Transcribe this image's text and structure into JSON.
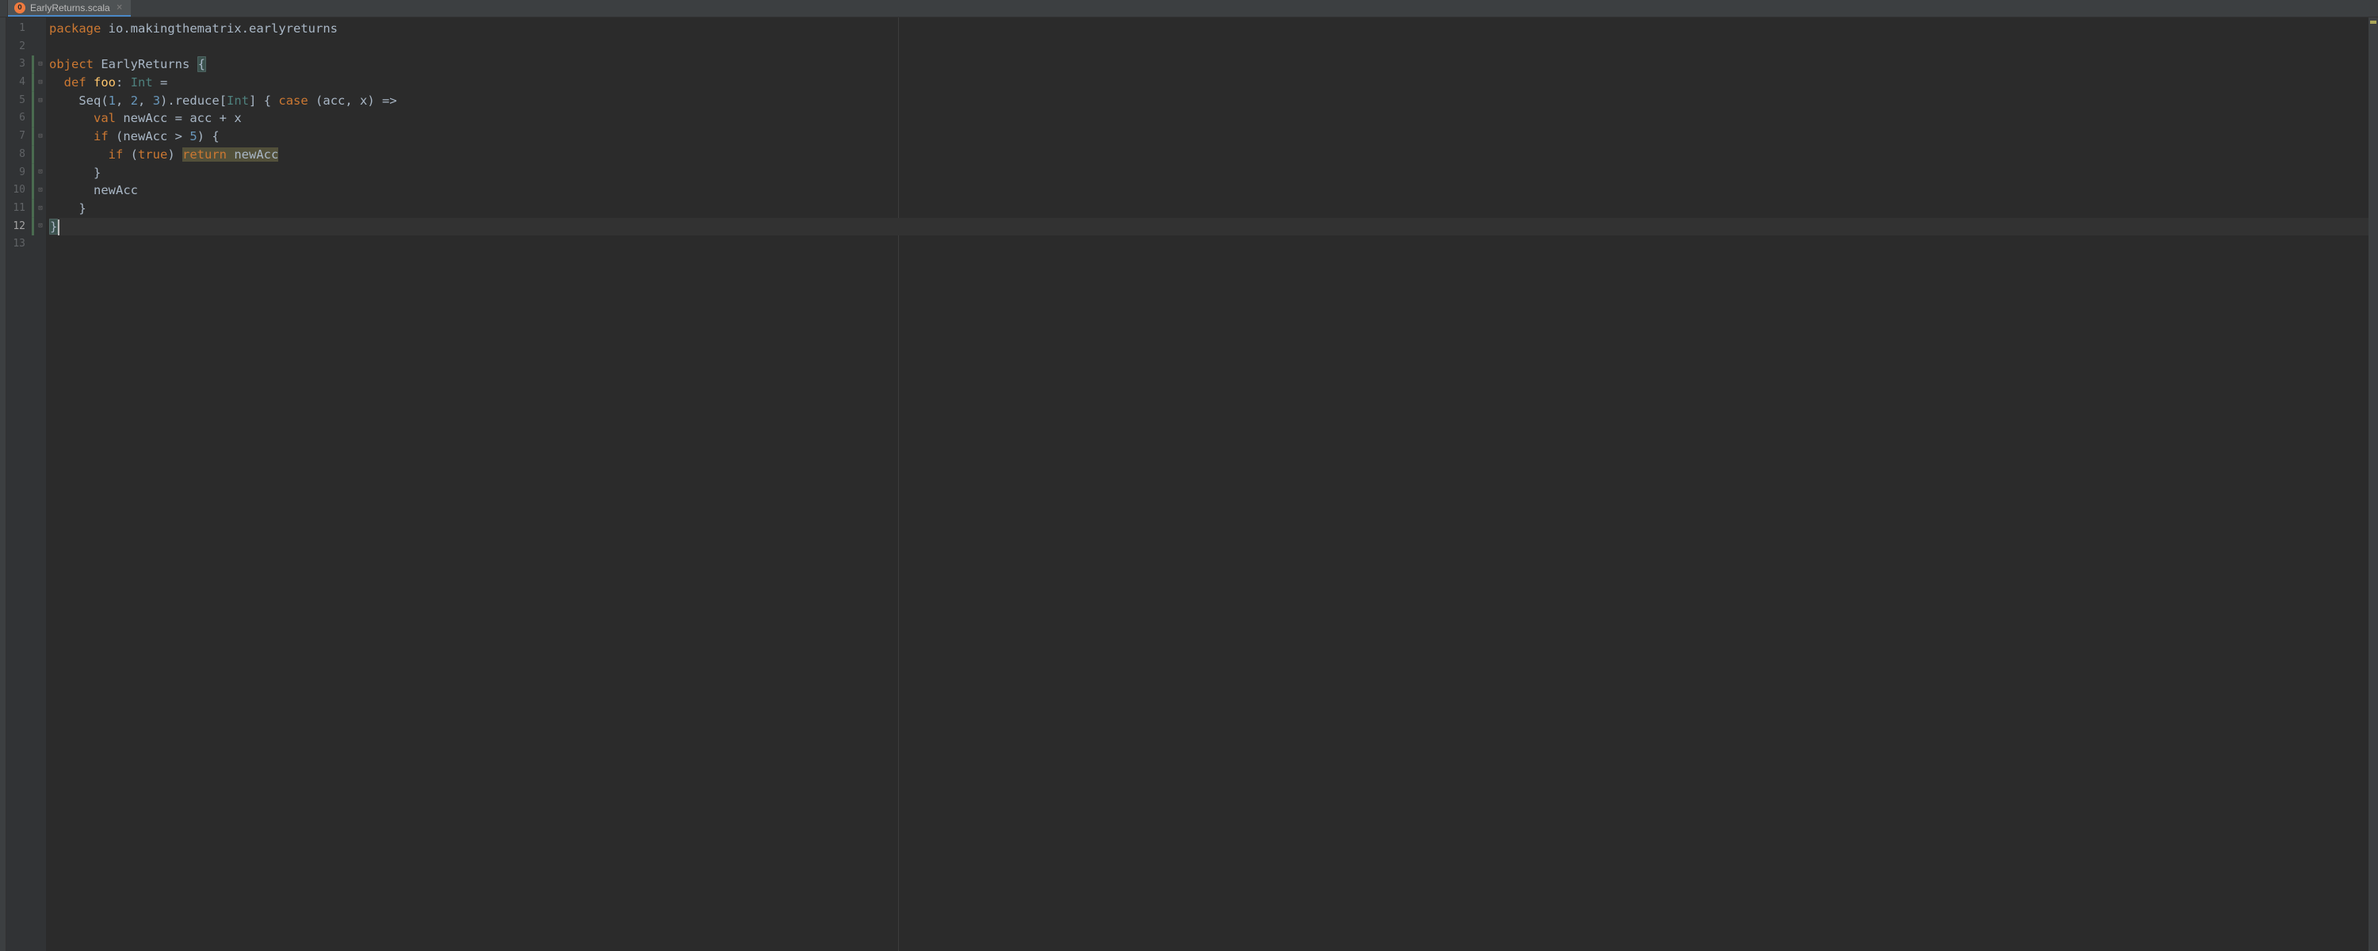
{
  "tab": {
    "label": "EarlyReturns.scala",
    "icon_letter": "O"
  },
  "gutter": {
    "line_count": 13,
    "active_line": 12
  },
  "code": {
    "lines": [
      {
        "n": 1,
        "segments": [
          {
            "t": "package",
            "c": "kw"
          },
          {
            "t": " ",
            "c": ""
          },
          {
            "t": "io.makingthematrix",
            "c": "pkg"
          },
          {
            "t": ".",
            "c": "pkg"
          },
          {
            "t": "earlyreturns",
            "c": "pkg"
          }
        ],
        "vcs": null,
        "fold": null
      },
      {
        "n": 2,
        "segments": [],
        "vcs": null,
        "fold": null
      },
      {
        "n": 3,
        "segments": [
          {
            "t": "object",
            "c": "kw"
          },
          {
            "t": " ",
            "c": ""
          },
          {
            "t": "EarlyReturns",
            "c": "cls"
          },
          {
            "t": " ",
            "c": ""
          },
          {
            "t": "{",
            "c": "brace-match"
          }
        ],
        "vcs": "added",
        "fold": "open",
        "fold_side": "left"
      },
      {
        "n": 4,
        "segments": [
          {
            "t": "  ",
            "c": ""
          },
          {
            "t": "def",
            "c": "kw"
          },
          {
            "t": " ",
            "c": ""
          },
          {
            "t": "foo",
            "c": "fn"
          },
          {
            "t": ": ",
            "c": "op"
          },
          {
            "t": "Int",
            "c": "type"
          },
          {
            "t": " = ",
            "c": "op"
          }
        ],
        "vcs": "added",
        "fold": "open"
      },
      {
        "n": 5,
        "segments": [
          {
            "t": "    ",
            "c": ""
          },
          {
            "t": "Seq",
            "c": "cls"
          },
          {
            "t": "(",
            "c": "paren"
          },
          {
            "t": "1",
            "c": "num"
          },
          {
            "t": ", ",
            "c": "op"
          },
          {
            "t": "2",
            "c": "num"
          },
          {
            "t": ", ",
            "c": "op"
          },
          {
            "t": "3",
            "c": "num"
          },
          {
            "t": ").reduce[",
            "c": "paren"
          },
          {
            "t": "Int",
            "c": "type"
          },
          {
            "t": "] { ",
            "c": "paren"
          },
          {
            "t": "case",
            "c": "kw"
          },
          {
            "t": " (acc, x) =>",
            "c": "op"
          }
        ],
        "vcs": "added",
        "fold": "open"
      },
      {
        "n": 6,
        "segments": [
          {
            "t": "      ",
            "c": ""
          },
          {
            "t": "val",
            "c": "kw"
          },
          {
            "t": " ",
            "c": ""
          },
          {
            "t": "newAcc = acc + x",
            "c": "str"
          }
        ],
        "vcs": "added",
        "fold": null
      },
      {
        "n": 7,
        "segments": [
          {
            "t": "      ",
            "c": ""
          },
          {
            "t": "if",
            "c": "kw"
          },
          {
            "t": " (newAcc > ",
            "c": "str"
          },
          {
            "t": "5",
            "c": "num"
          },
          {
            "t": ") {",
            "c": "str"
          }
        ],
        "vcs": "added",
        "fold": "open"
      },
      {
        "n": 8,
        "segments": [
          {
            "t": "        ",
            "c": ""
          },
          {
            "t": "if",
            "c": "kw"
          },
          {
            "t": " (",
            "c": "str"
          },
          {
            "t": "true",
            "c": "kw"
          },
          {
            "t": ") ",
            "c": "str"
          },
          {
            "t": "return",
            "c": "kw hl-return"
          },
          {
            "t": " newAcc",
            "c": "str hl-return"
          }
        ],
        "vcs": "added",
        "fold": null
      },
      {
        "n": 9,
        "segments": [
          {
            "t": "      }",
            "c": "str"
          }
        ],
        "vcs": "added",
        "fold": "close"
      },
      {
        "n": 10,
        "segments": [
          {
            "t": "      newAcc",
            "c": "str"
          }
        ],
        "vcs": "added",
        "fold": "close"
      },
      {
        "n": 11,
        "segments": [
          {
            "t": "    }",
            "c": "str"
          }
        ],
        "vcs": "added",
        "fold": "close"
      },
      {
        "n": 12,
        "segments": [
          {
            "t": "}",
            "c": "brace-match-cursor"
          }
        ],
        "vcs": "added",
        "fold": "close",
        "current": true,
        "cursor": true
      },
      {
        "n": 13,
        "segments": [],
        "vcs": null,
        "fold": null
      }
    ]
  }
}
